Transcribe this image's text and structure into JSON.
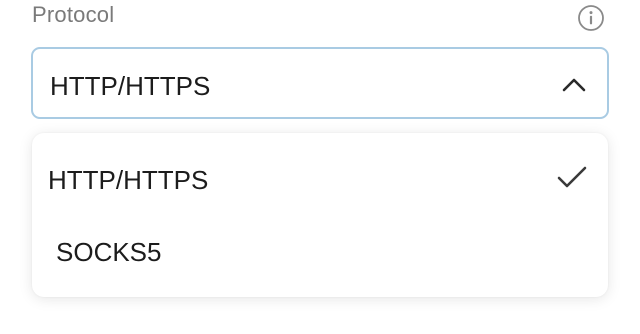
{
  "field": {
    "label": "Protocol",
    "info_icon": "info-icon"
  },
  "select": {
    "value": "HTTP/HTTPS",
    "expanded": true,
    "chevron_icon": "chevron-up-icon",
    "border_color": "#a9cbe3"
  },
  "dropdown": {
    "options": [
      {
        "label": "HTTP/HTTPS",
        "selected": true,
        "icon": "check-icon"
      },
      {
        "label": "SOCKS5",
        "selected": false
      }
    ]
  }
}
